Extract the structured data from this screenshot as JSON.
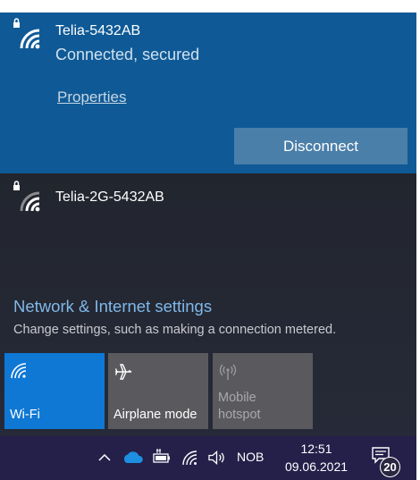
{
  "connected_network": {
    "name": "Telia-5432AB",
    "status": "Connected, secured",
    "properties_label": "Properties",
    "disconnect_label": "Disconnect"
  },
  "other_network": {
    "name": "Telia-2G-5432AB"
  },
  "settings": {
    "title": "Network & Internet settings",
    "subtitle": "Change settings, such as making a connection metered."
  },
  "quick_actions": [
    {
      "label": "Wi-Fi",
      "icon": "wifi-icon",
      "state": "on",
      "color": "#0f78d4"
    },
    {
      "label": "Airplane mode",
      "icon": "airplane-icon",
      "state": "off",
      "color": "#5a5a5e"
    },
    {
      "label": "Mobile hotspot",
      "icon": "hotspot-icon",
      "state": "disabled",
      "color": "#5a5a5e"
    }
  ],
  "taskbar": {
    "icons": [
      "chevron-up-icon",
      "onedrive-icon",
      "battery-icon",
      "wifi-icon",
      "volume-icon"
    ],
    "language": "NOB",
    "time": "12:51",
    "date": "09.06.2021",
    "notification_count": "20"
  },
  "colors": {
    "accent": "#0f5a96",
    "disconnect_button": "#4a7fa9",
    "link": "#7fb8e8",
    "taskbar": "#24204a"
  }
}
